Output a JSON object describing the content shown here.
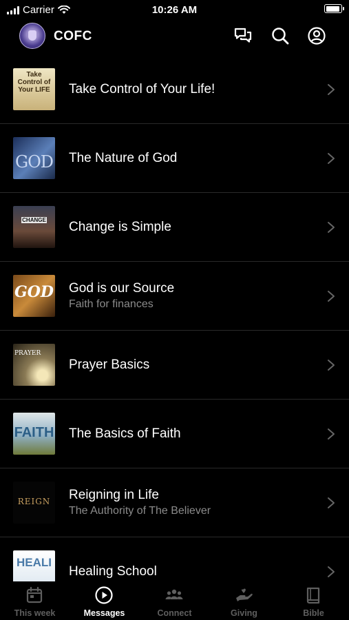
{
  "status_bar": {
    "carrier": "Carrier",
    "time": "10:26 AM"
  },
  "header": {
    "title": "COFC"
  },
  "messages": [
    {
      "title": "Take Control of Your Life!",
      "subtitle": "",
      "thumb_text": "Take Control of Your LIFE"
    },
    {
      "title": "The Nature of God",
      "subtitle": "",
      "thumb_text": "GOD"
    },
    {
      "title": "Change is Simple",
      "subtitle": "",
      "thumb_text": "CHANGE"
    },
    {
      "title": "God is our Source",
      "subtitle": "Faith for finances",
      "thumb_text": "GOD"
    },
    {
      "title": "Prayer Basics",
      "subtitle": "",
      "thumb_text": "PRAYER"
    },
    {
      "title": "The Basics of Faith",
      "subtitle": "",
      "thumb_text": "FAITH"
    },
    {
      "title": "Reigning in Life",
      "subtitle": "The Authority of The Believer",
      "thumb_text": "REIGN"
    },
    {
      "title": "Healing School",
      "subtitle": "",
      "thumb_text": "HEALI"
    }
  ],
  "tabs": [
    {
      "label": "This week",
      "icon": "calendar-icon",
      "active": false
    },
    {
      "label": "Messages",
      "icon": "play-circle-icon",
      "active": true
    },
    {
      "label": "Connect",
      "icon": "people-icon",
      "active": false
    },
    {
      "label": "Giving",
      "icon": "giving-hand-icon",
      "active": false
    },
    {
      "label": "Bible",
      "icon": "book-icon",
      "active": false
    }
  ],
  "colors": {
    "background": "#000000",
    "divider": "#2a2a2a",
    "subtitle": "#8b8b8b",
    "inactive_tab": "#5f5f5f",
    "active_tab": "#ffffff"
  }
}
